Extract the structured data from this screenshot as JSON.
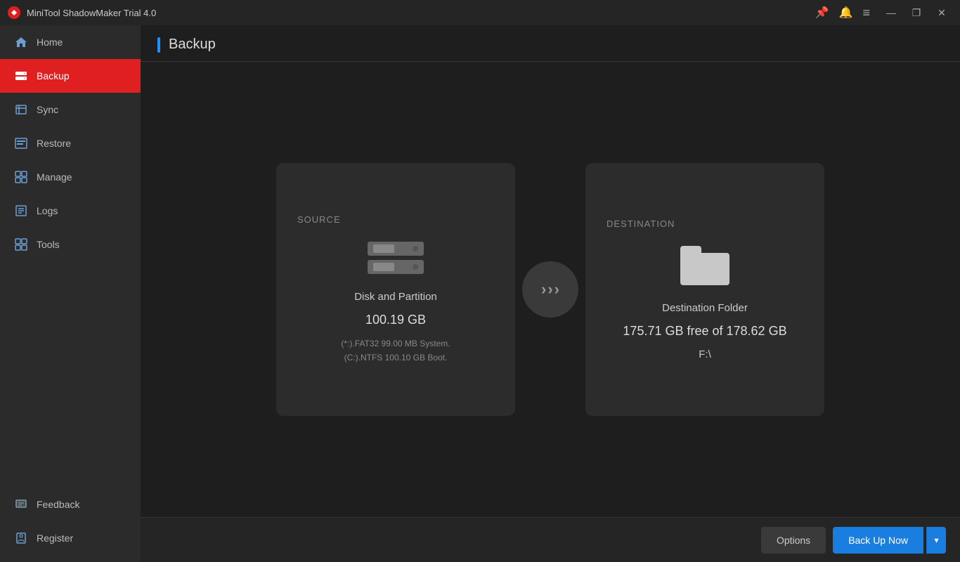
{
  "titlebar": {
    "title": "MiniTool ShadowMaker Trial 4.0",
    "controls": {
      "minimize": "—",
      "maximize": "❐",
      "close": "✕"
    }
  },
  "sidebar": {
    "items": [
      {
        "id": "home",
        "label": "Home",
        "active": false
      },
      {
        "id": "backup",
        "label": "Backup",
        "active": true
      },
      {
        "id": "sync",
        "label": "Sync",
        "active": false
      },
      {
        "id": "restore",
        "label": "Restore",
        "active": false
      },
      {
        "id": "manage",
        "label": "Manage",
        "active": false
      },
      {
        "id": "logs",
        "label": "Logs",
        "active": false
      },
      {
        "id": "tools",
        "label": "Tools",
        "active": false
      }
    ],
    "bottom": [
      {
        "id": "feedback",
        "label": "Feedback"
      },
      {
        "id": "register",
        "label": "Register"
      }
    ]
  },
  "page": {
    "title": "Backup"
  },
  "source_card": {
    "label": "SOURCE",
    "main_text": "Disk and Partition",
    "size_text": "100.19 GB",
    "sub_line1": "(*:).FAT32 99.00 MB System.",
    "sub_line2": "(C:).NTFS 100.10 GB Boot."
  },
  "destination_card": {
    "label": "DESTINATION",
    "main_text": "Destination Folder",
    "free_text": "175.71 GB free of 178.62 GB",
    "path_text": "F:\\"
  },
  "bottom_bar": {
    "options_label": "Options",
    "backup_now_label": "Back Up Now",
    "dropdown_arrow": "▾"
  }
}
